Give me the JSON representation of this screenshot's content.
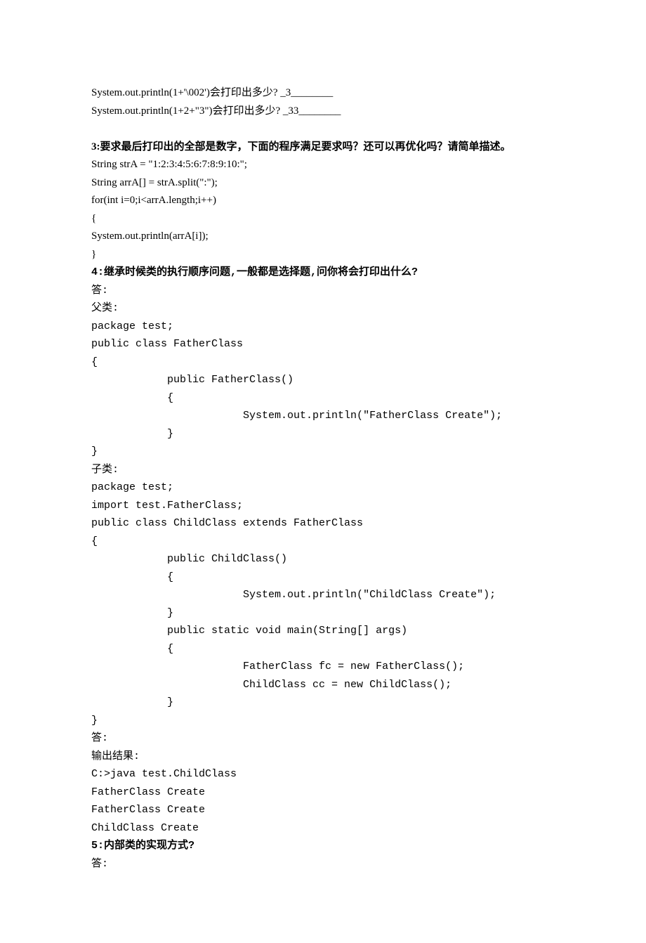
{
  "lines": [
    {
      "text": "System.out.println(1+'\\002')会打印出多少? _3________",
      "cls": "line"
    },
    {
      "text": "System.out.println(1+2+\"3\")会打印出多少? _33________",
      "cls": "line"
    },
    {
      "text": " ",
      "cls": "line"
    },
    {
      "text": "3:要求最后打印出的全部是数字，下面的程序满足要求吗？还可以再优化吗？请简单描述。",
      "cls": "line bold"
    },
    {
      "text": "String strA = \"1:2:3:4:5:6:7:8:9:10:\";",
      "cls": "line"
    },
    {
      "text": "String arrA[] = strA.split(\":\");",
      "cls": "line"
    },
    {
      "text": "for(int i=0;i<arrA.length;i++)",
      "cls": "line"
    },
    {
      "text": "{",
      "cls": "line"
    },
    {
      "text": "System.out.println(arrA[i]);",
      "cls": "line"
    },
    {
      "text": "}",
      "cls": "line"
    },
    {
      "text": "4:继承时候类的执行顺序问题,一般都是选择题,问你将会打印出什么?",
      "cls": "mono bold"
    },
    {
      "text": "答:",
      "cls": "mono"
    },
    {
      "text": "父类:",
      "cls": "mono"
    },
    {
      "text": "package test;",
      "cls": "mono"
    },
    {
      "text": "public class FatherClass",
      "cls": "mono"
    },
    {
      "text": "{",
      "cls": "mono"
    },
    {
      "text": "            public FatherClass()",
      "cls": "mono"
    },
    {
      "text": "            {",
      "cls": "mono"
    },
    {
      "text": "                        System.out.println(\"FatherClass Create\");",
      "cls": "mono"
    },
    {
      "text": "            }",
      "cls": "mono"
    },
    {
      "text": "}",
      "cls": "mono"
    },
    {
      "text": "子类:",
      "cls": "mono"
    },
    {
      "text": "package test;",
      "cls": "mono"
    },
    {
      "text": "import test.FatherClass;",
      "cls": "mono"
    },
    {
      "text": "public class ChildClass extends FatherClass",
      "cls": "mono"
    },
    {
      "text": "{",
      "cls": "mono"
    },
    {
      "text": "            public ChildClass()",
      "cls": "mono"
    },
    {
      "text": "            {",
      "cls": "mono"
    },
    {
      "text": "                        System.out.println(\"ChildClass Create\");",
      "cls": "mono"
    },
    {
      "text": "            }",
      "cls": "mono"
    },
    {
      "text": "            public static void main(String[] args)",
      "cls": "mono"
    },
    {
      "text": "            {",
      "cls": "mono"
    },
    {
      "text": "                        FatherClass fc = new FatherClass();",
      "cls": "mono"
    },
    {
      "text": "                        ChildClass cc = new ChildClass();",
      "cls": "mono"
    },
    {
      "text": "            }",
      "cls": "mono"
    },
    {
      "text": "}",
      "cls": "mono"
    },
    {
      "text": "答:",
      "cls": "mono"
    },
    {
      "text": "输出结果:",
      "cls": "mono"
    },
    {
      "text": "C:>java test.ChildClass",
      "cls": "mono"
    },
    {
      "text": "FatherClass Create",
      "cls": "mono"
    },
    {
      "text": "FatherClass Create",
      "cls": "mono"
    },
    {
      "text": "ChildClass Create",
      "cls": "mono"
    },
    {
      "text": "5:内部类的实现方式?",
      "cls": "mono bold"
    },
    {
      "text": "答:",
      "cls": "mono"
    }
  ]
}
